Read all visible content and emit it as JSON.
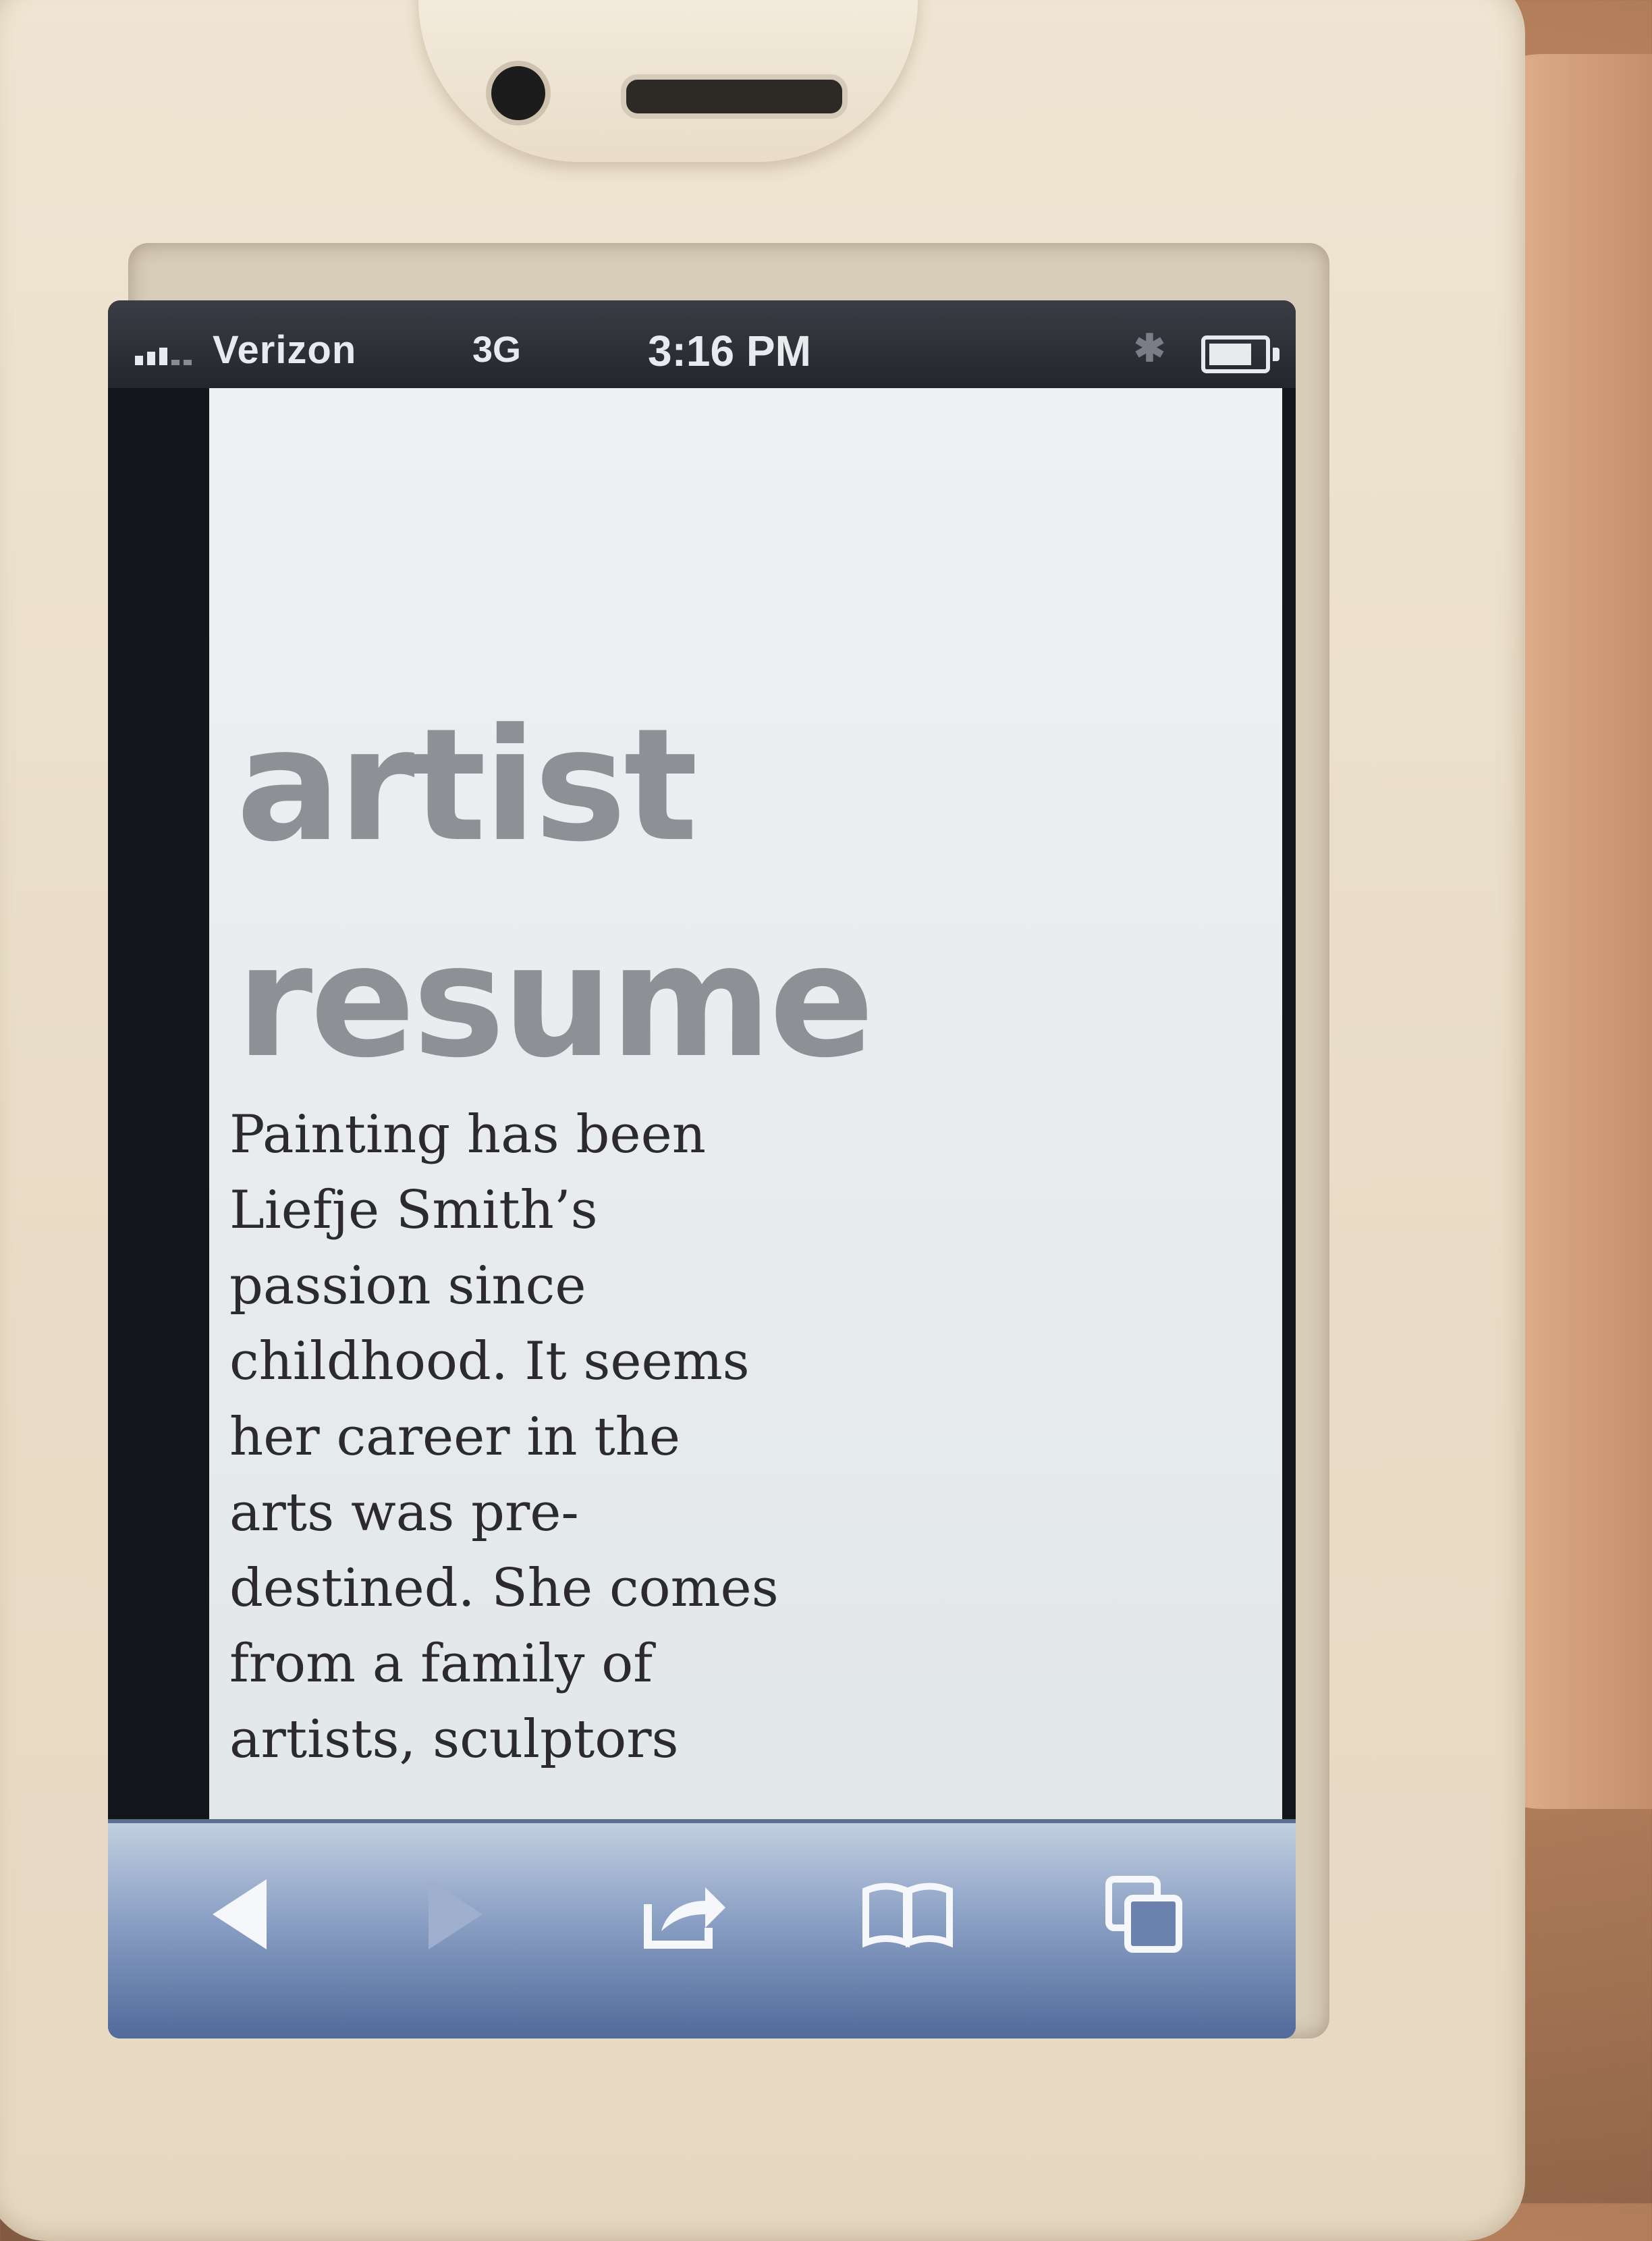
{
  "status_bar": {
    "carrier": "Verizon",
    "network": "3G",
    "time": "3:16 PM",
    "signal_bars": 3,
    "battery_level": 0.8
  },
  "page": {
    "heading_lines": [
      "artist",
      "resume"
    ],
    "paragraph_lines": [
      "Painting has been",
      "Liefje Smith’s",
      "passion since",
      "childhood. It seems",
      "her career in the",
      "arts was pre-",
      "destined. She comes",
      "from a family of",
      "artists, sculptors"
    ]
  },
  "toolbar": {
    "buttons": [
      {
        "name": "back-button",
        "icon": "back-arrow-icon",
        "enabled": true
      },
      {
        "name": "forward-button",
        "icon": "forward-arrow-icon",
        "enabled": false
      },
      {
        "name": "share-button",
        "icon": "share-icon",
        "enabled": true
      },
      {
        "name": "bookmarks-button",
        "icon": "book-icon",
        "enabled": true
      },
      {
        "name": "tabs-button",
        "icon": "tabs-icon",
        "enabled": true
      }
    ]
  },
  "colors": {
    "heading": "#8e9095",
    "body_text": "#2c2a2d",
    "toolbar_top": "#c2cfe0",
    "toolbar_bottom": "#4e6899",
    "case": "#e9ddc7"
  }
}
